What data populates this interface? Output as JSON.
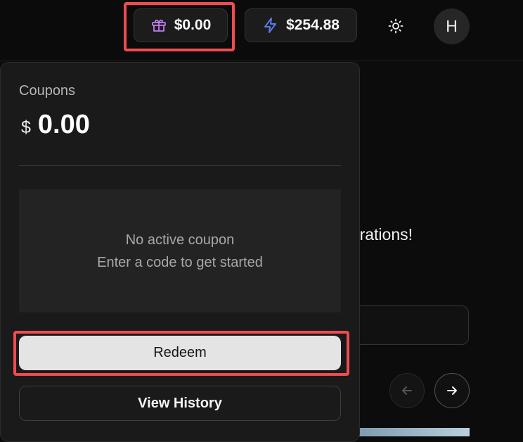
{
  "header": {
    "coupon_balance": "$0.00",
    "credit_balance": "$254.88",
    "avatar_initial": "H"
  },
  "background": {
    "headline_fragment": "perations!"
  },
  "coupons_popover": {
    "title": "Coupons",
    "currency_symbol": "$",
    "amount": "0.00",
    "empty_title": "No active coupon",
    "empty_subtitle": "Enter a code to get started",
    "redeem_label": "Redeem",
    "history_label": "View History"
  },
  "icons": {
    "coupon": "gift-icon",
    "credit": "lightning-icon",
    "theme": "sun-icon",
    "prev": "arrow-left-icon",
    "next": "arrow-right-icon"
  },
  "colors": {
    "gift_icon": "#c07cf0",
    "lightning_icon": "#5b7cf5",
    "highlight": "#f04b51"
  }
}
